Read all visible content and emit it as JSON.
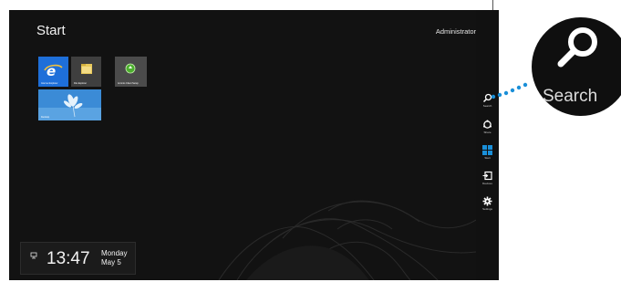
{
  "start_screen": {
    "title": "Start",
    "user_name": "Administrator"
  },
  "tiles": [
    {
      "label": "Internet Explorer",
      "icon": "internet-explorer-icon",
      "color": "#1e6fd9"
    },
    {
      "label": "File Explorer",
      "icon": "folder-icon",
      "color": "#3f3f3f"
    },
    {
      "label": "Acronis Client Setup",
      "icon": "acronis-icon",
      "color": "#4b4b4b"
    },
    {
      "label": "Desktop",
      "icon": "desktop-wallpaper",
      "color": "#3b8bd6"
    }
  ],
  "clock": {
    "time": "13:47",
    "day": "Monday",
    "date": "May 5"
  },
  "charms": {
    "search": "Search",
    "share": "Share",
    "start": "Start",
    "devices": "Devices",
    "settings": "Settings"
  },
  "zoom_callout": {
    "label": "Search",
    "icon": "search-icon",
    "accent_color": "#1a8fd8"
  }
}
